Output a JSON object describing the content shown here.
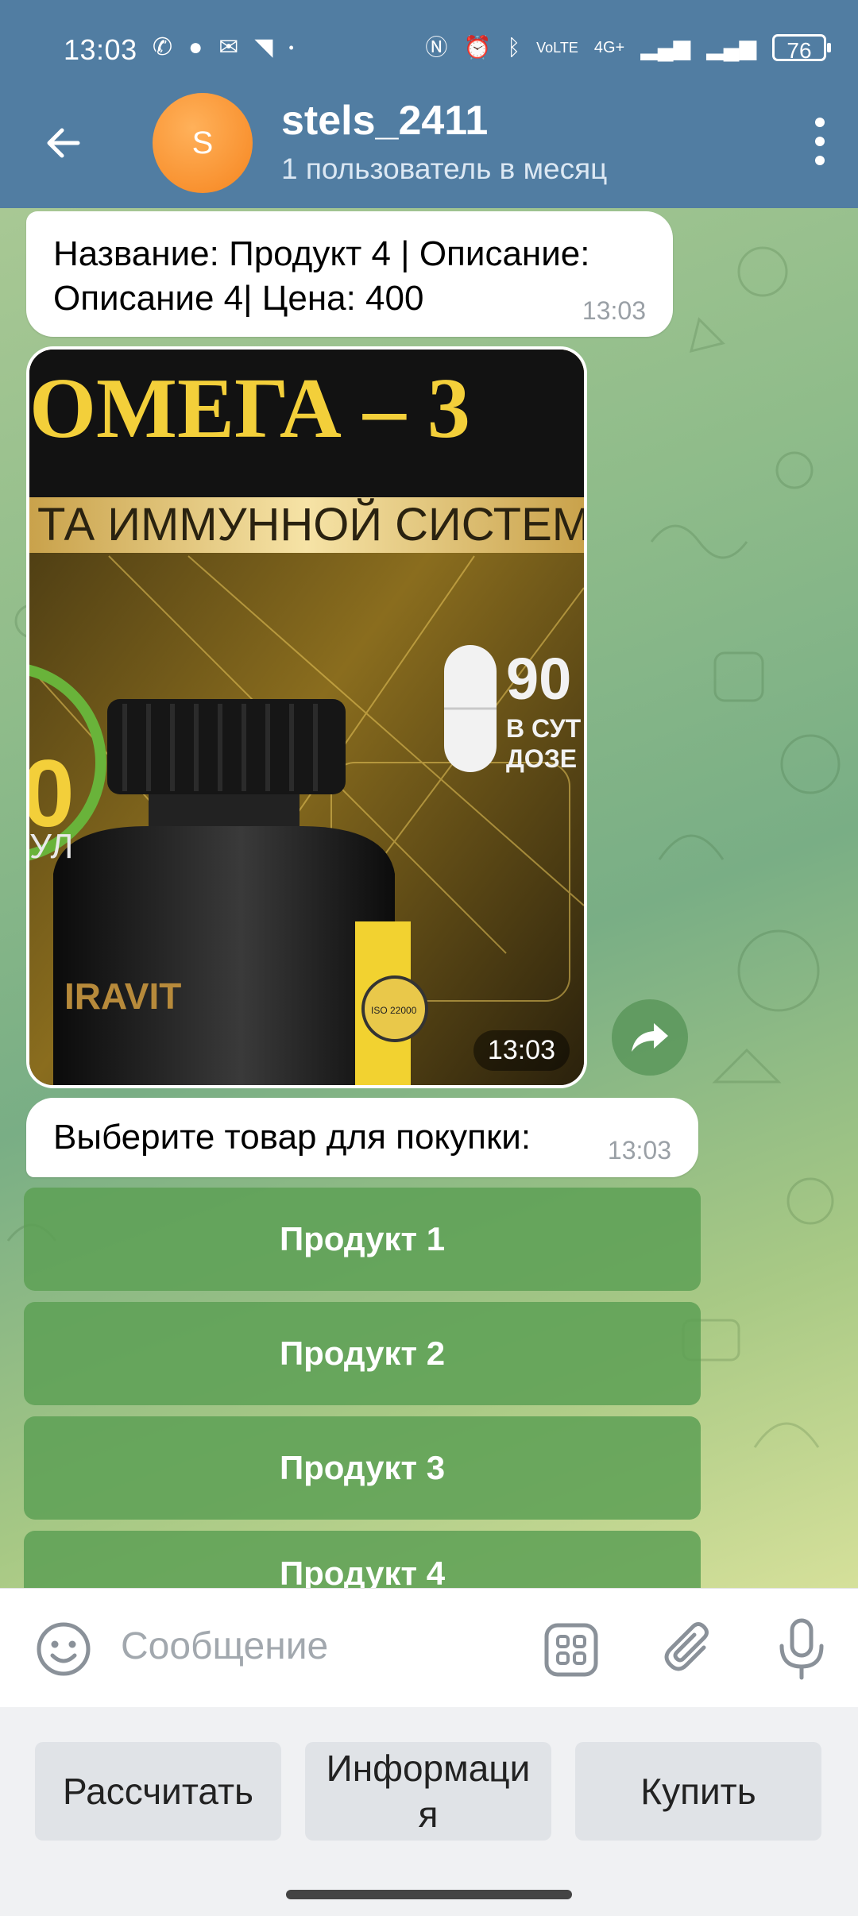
{
  "status_bar": {
    "time": "13:03",
    "battery": "76",
    "network": "4G+"
  },
  "header": {
    "avatar_letter": "S",
    "title": "stels_2411",
    "subtitle": "1 пользователь в месяц"
  },
  "messages": [
    {
      "text": "Название: Продукт 4 | Описание: Описание 4| Цена: 400",
      "time": "13:03"
    },
    {
      "type": "photo",
      "time": "13:03",
      "image_text": {
        "heading": "ОМЕГА – 3",
        "banner": "ТА ИММУННОЙ СИСТЕМ",
        "big_number": "90",
        "side_line1": "В СУТ",
        "side_line2": "ДОЗЕ",
        "left_number": "0",
        "left_label": "УЛ",
        "brand": "IRAVIT",
        "seal": "ISO 22000"
      }
    },
    {
      "text": "Выберите товар для покупки:",
      "time": "13:03"
    }
  ],
  "inline_keyboard": [
    "Продукт 1",
    "Продукт 2",
    "Продукт 3",
    "Продукт 4"
  ],
  "input": {
    "placeholder": "Сообщение"
  },
  "reply_keyboard": [
    "Рассчитать",
    "Информаци я",
    "Купить"
  ],
  "colors": {
    "header": "#517da2",
    "button": "#5da055",
    "avatar": "#f6851f"
  }
}
